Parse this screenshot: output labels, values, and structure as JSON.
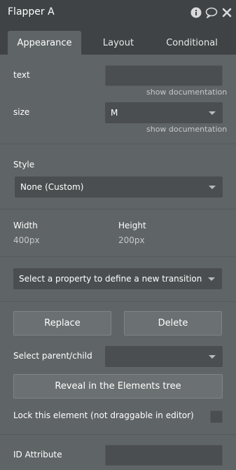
{
  "window": {
    "title": "Flapper A",
    "icons": [
      "info-icon",
      "comment-icon",
      "close-icon"
    ]
  },
  "tabs": [
    {
      "label": "Appearance",
      "active": true
    },
    {
      "label": "Layout",
      "active": false
    },
    {
      "label": "Conditional",
      "active": false
    }
  ],
  "fields": {
    "text": {
      "label": "text",
      "value": "",
      "help": "show documentation"
    },
    "size": {
      "label": "size",
      "value": "M",
      "help": "show documentation"
    }
  },
  "style": {
    "label": "Style",
    "value": "None (Custom)"
  },
  "dimensions": {
    "width_label": "Width",
    "width_value": "400px",
    "height_label": "Height",
    "height_value": "200px"
  },
  "transition": {
    "placeholder": "Select a property to define a new transition"
  },
  "actions": {
    "replace": "Replace",
    "delete": "Delete"
  },
  "parent_child": {
    "label": "Select parent/child",
    "value": ""
  },
  "reveal": {
    "label": "Reveal in the Elements tree"
  },
  "lock": {
    "label": "Lock this element (not draggable in editor)",
    "checked": false
  },
  "id_attribute": {
    "label": "ID Attribute",
    "value": ""
  },
  "colors": {
    "panel": "#5f6466",
    "header": "#3f4345",
    "input": "#4a4e50",
    "button": "#6b7072"
  }
}
